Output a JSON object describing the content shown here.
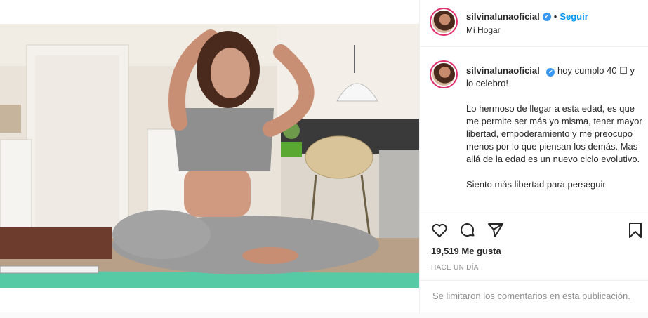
{
  "post": {
    "username": "silvinalunaoficial",
    "verified_mark": "✔",
    "dot": "•",
    "follow_label": "Seguir",
    "location": "Mi Hogar",
    "caption_lines": [
      "hoy cumplo 40 ☐ y lo celebro!",
      "Lo hermoso de llegar a esta edad, es que me permite ser más yo misma, tener mayor libertad, empoderamiento y me preocupo menos por lo que piensan los demás. Mas allá de la edad es un nuevo ciclo evolutivo.",
      "Siento más libertad para perseguir"
    ],
    "likes_count": "19,519",
    "likes_label": "Me gusta",
    "timestamp": "HACE UN DÍA",
    "comments_limited": "Se limitaron los comentarios en esta publicación.",
    "icons": [
      "heart-icon",
      "comment-icon",
      "share-icon",
      "bookmark-icon",
      "verified-badge-icon"
    ],
    "colors": {
      "accent": "#0095f6",
      "verified": "#3897f0",
      "muted": "#8e8e8e",
      "mat": "#56c9a5"
    }
  }
}
